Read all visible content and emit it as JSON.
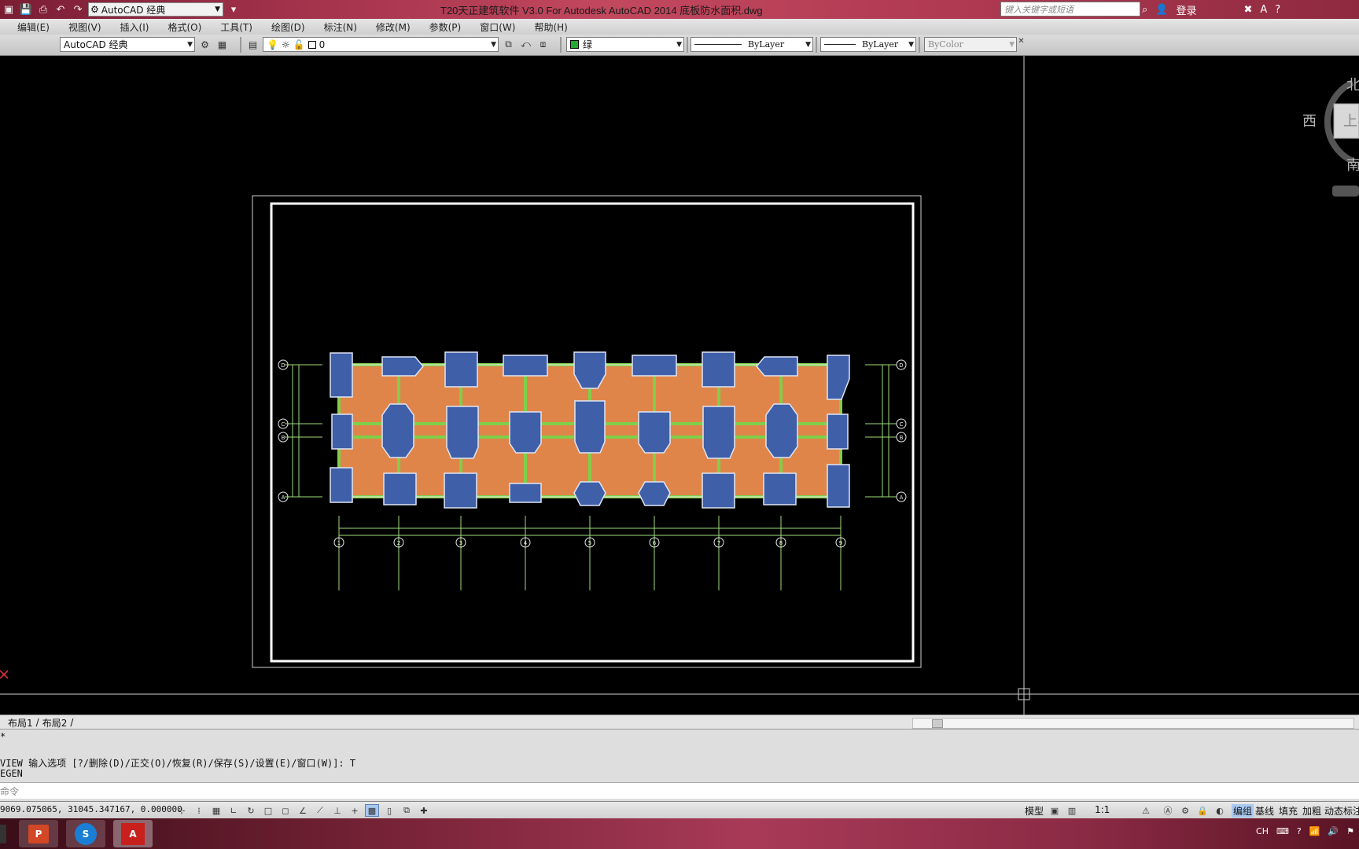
{
  "window": {
    "title": "T20天正建筑软件 V3.0 For Autodesk AutoCAD 2014    底板防水面积.dwg",
    "workspace": "AutoCAD 经典",
    "search_placeholder": "键入关键字或短语",
    "login": "登录",
    "help": "?"
  },
  "menu": [
    "编辑(E)",
    "视图(V)",
    "插入(I)",
    "格式(O)",
    "工具(T)",
    "绘图(D)",
    "标注(N)",
    "修改(M)",
    "参数(P)",
    "窗口(W)",
    "帮助(H)"
  ],
  "toolbar": {
    "workspace_combo": "AutoCAD 经典",
    "layer_combo": "0",
    "color_combo": "绿",
    "linetype_combo": "ByLayer",
    "lineweight_combo": "ByLayer",
    "plotstyle_combo": "ByColor"
  },
  "colors": {
    "slab": "#e0854a",
    "column": "#3f5fa8",
    "beam": "#7fcf4a",
    "layer_swatch": "#22aa33"
  },
  "compass": {
    "north": "北",
    "west": "西",
    "south": "南",
    "top": "上"
  },
  "drawing": {
    "grid_bottom": [
      "1",
      "2",
      "3",
      "4",
      "5",
      "6",
      "7",
      "8",
      "9"
    ],
    "grid_side": [
      "D",
      "C",
      "B",
      "A"
    ]
  },
  "tabs": [
    "布局1",
    "布局2"
  ],
  "command": {
    "line1": "*",
    "line2": "VIEW 输入选项 [?/删除(D)/正交(O)/恢复(R)/保存(S)/设置(E)/窗口(W)]: T",
    "line3": "EGEN",
    "prompt": "命令"
  },
  "status": {
    "coords": "9069.075065,   31045.347167, 0.000000",
    "model": "模型",
    "scale": "1:1",
    "right_items": [
      "编组",
      "基线",
      "填充",
      "加粗",
      "动态标注"
    ]
  },
  "tray": {
    "lang": "CH"
  }
}
